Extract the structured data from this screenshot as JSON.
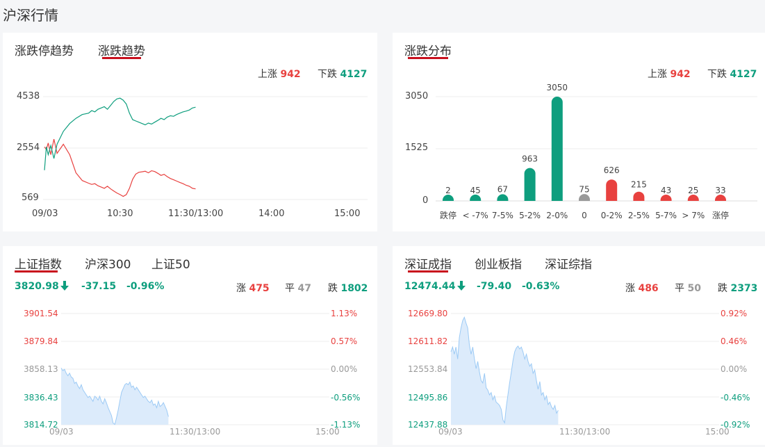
{
  "page_title": "沪深行情",
  "colors": {
    "up": "#e8413f",
    "down": "#0e9e7e",
    "flat": "#999999",
    "accent": "#c8101d",
    "area": "#dcebfb",
    "area_line": "#9ccaf5"
  },
  "trend_card": {
    "tabs": [
      {
        "label": "涨跌停趋势",
        "active": false
      },
      {
        "label": "涨跌趋势",
        "active": true
      }
    ],
    "up_label": "上涨",
    "up_value": "942",
    "down_label": "下跌",
    "down_value": "4127",
    "y_ticks": [
      "4538",
      "2554",
      "569"
    ],
    "x_ticks": [
      "09/03",
      "10:30",
      "11:30/13:00",
      "14:00",
      "15:00"
    ]
  },
  "dist_card": {
    "tabs": [
      {
        "label": "涨跌分布",
        "active": true
      }
    ],
    "up_label": "上涨",
    "up_value": "942",
    "down_label": "下跌",
    "down_value": "4127",
    "y_ticks": [
      "3050",
      "1525",
      "0"
    ]
  },
  "sh_card": {
    "tabs": [
      {
        "label": "上证指数",
        "active": true
      },
      {
        "label": "沪深300",
        "active": false
      },
      {
        "label": "上证50",
        "active": false
      }
    ],
    "price": "3820.98",
    "change": "-37.15",
    "change_pct": "-0.96%",
    "up_label": "涨",
    "up_value": "475",
    "flat_label": "平",
    "flat_value": "47",
    "down_label": "跌",
    "down_value": "1802",
    "left_ticks": [
      "3901.54",
      "3879.84",
      "3858.13",
      "3836.43",
      "3814.72"
    ],
    "right_ticks": [
      "1.13%",
      "0.57%",
      "0.00%",
      "-0.56%",
      "-1.13%"
    ],
    "x_ticks": [
      "09/03",
      "11:30/13:00",
      "15:00"
    ]
  },
  "sz_card": {
    "tabs": [
      {
        "label": "深证成指",
        "active": true
      },
      {
        "label": "创业板指",
        "active": false
      },
      {
        "label": "深证综指",
        "active": false
      }
    ],
    "price": "12474.44",
    "change": "-79.40",
    "change_pct": "-0.63%",
    "up_label": "涨",
    "up_value": "486",
    "flat_label": "平",
    "flat_value": "50",
    "down_label": "跌",
    "down_value": "2373",
    "left_ticks": [
      "12669.80",
      "12611.82",
      "12553.84",
      "12495.86",
      "12437.88"
    ],
    "right_ticks": [
      "0.92%",
      "0.46%",
      "0.00%",
      "-0.46%",
      "-0.92%"
    ],
    "x_ticks": [
      "09/03",
      "11:30/13:00",
      "15:00"
    ]
  },
  "chart_data": [
    {
      "type": "line",
      "ylim": [
        569,
        4538
      ],
      "x_ticks": [
        "09/03",
        "10:30",
        "11:30/13:00",
        "14:00",
        "15:00"
      ],
      "series": [
        {
          "name": "上涨",
          "color": "#e8413f",
          "x": [
            0,
            3,
            6,
            10,
            15,
            20,
            30,
            40,
            50,
            60,
            70,
            75,
            80,
            85,
            90,
            95,
            100,
            105,
            110,
            115,
            120,
            125,
            130,
            135,
            140,
            145,
            150,
            155,
            160,
            165,
            170,
            175,
            180,
            185,
            190,
            195,
            200,
            205,
            210,
            215,
            220,
            225,
            230,
            235,
            240
          ],
          "y": [
            2600,
            2500,
            2750,
            2300,
            2900,
            2350,
            2700,
            2300,
            1600,
            1300,
            1200,
            1150,
            1180,
            1100,
            1050,
            1000,
            1080,
            980,
            900,
            820,
            760,
            690,
            760,
            1000,
            1350,
            1550,
            1620,
            1640,
            1660,
            1600,
            1680,
            1650,
            1580,
            1500,
            1540,
            1450,
            1380,
            1330,
            1280,
            1230,
            1180,
            1120,
            1080,
            1000,
            980
          ]
        },
        {
          "name": "下跌",
          "color": "#0e9e7e",
          "x": [
            0,
            3,
            6,
            10,
            15,
            20,
            30,
            40,
            50,
            60,
            70,
            75,
            80,
            85,
            90,
            95,
            100,
            105,
            110,
            115,
            120,
            125,
            130,
            135,
            140,
            145,
            150,
            155,
            160,
            165,
            170,
            175,
            180,
            185,
            190,
            195,
            200,
            205,
            210,
            215,
            220,
            225,
            230,
            235,
            240
          ],
          "y": [
            1700,
            2600,
            2300,
            2650,
            2150,
            2700,
            3200,
            3500,
            3700,
            3850,
            3900,
            4000,
            3950,
            4050,
            4100,
            4150,
            4050,
            4200,
            4350,
            4450,
            4480,
            4400,
            4250,
            3900,
            3650,
            3600,
            3550,
            3500,
            3450,
            3520,
            3480,
            3550,
            3620,
            3700,
            3650,
            3750,
            3800,
            3780,
            3850,
            3900,
            3950,
            3980,
            4020,
            4100,
            4130
          ]
        }
      ]
    },
    {
      "type": "bar",
      "categories": [
        "跌停",
        "< -7%",
        "7-5%",
        "5-2%",
        "2-0%",
        "0",
        "0-2%",
        "2-5%",
        "5-7%",
        "> 7%",
        "涨停"
      ],
      "values": [
        2,
        45,
        67,
        963,
        3050,
        75,
        626,
        215,
        43,
        25,
        33
      ],
      "colors": [
        "#0e9e7e",
        "#0e9e7e",
        "#0e9e7e",
        "#0e9e7e",
        "#0e9e7e",
        "#999999",
        "#e8413f",
        "#e8413f",
        "#e8413f",
        "#e8413f",
        "#e8413f"
      ],
      "ylim": [
        0,
        3050
      ]
    },
    {
      "type": "area",
      "ylim": [
        3814.72,
        3901.54
      ],
      "x_ticks": [
        "09/03",
        "11:30/13:00",
        "15:00"
      ],
      "x": [
        0,
        3,
        6,
        9,
        12,
        15,
        18,
        21,
        24,
        27,
        30,
        33,
        36,
        39,
        42,
        45,
        48,
        51,
        54,
        57,
        60,
        63,
        66,
        69,
        72,
        75,
        78,
        81,
        84,
        87,
        90,
        93,
        96,
        99,
        102,
        105,
        108,
        111,
        114,
        117,
        120,
        123,
        126,
        129,
        132,
        135,
        138,
        141,
        144,
        147,
        150,
        153,
        156,
        159,
        162,
        165,
        168,
        171,
        174,
        177,
        180,
        183,
        186,
        189,
        192
      ],
      "y": [
        3859,
        3857,
        3858,
        3855,
        3853,
        3855,
        3852,
        3851,
        3847,
        3848,
        3845,
        3843,
        3846,
        3842,
        3840,
        3838,
        3836,
        3837,
        3835,
        3833,
        3837,
        3836,
        3834,
        3837,
        3833,
        3831,
        3835,
        3832,
        3828,
        3825,
        3822,
        3816,
        3815,
        3820,
        3826,
        3833,
        3840,
        3843,
        3846,
        3847,
        3846,
        3848,
        3844,
        3845,
        3842,
        3844,
        3842,
        3840,
        3838,
        3836,
        3837,
        3835,
        3833,
        3832,
        3834,
        3830,
        3831,
        3828,
        3833,
        3829,
        3830,
        3832,
        3829,
        3826,
        3821
      ]
    },
    {
      "type": "area",
      "ylim": [
        12437.88,
        12669.8
      ],
      "x_ticks": [
        "09/03",
        "11:30/13:00",
        "15:00"
      ],
      "x": [
        0,
        3,
        6,
        9,
        12,
        15,
        18,
        21,
        24,
        27,
        30,
        33,
        36,
        39,
        42,
        45,
        48,
        51,
        54,
        57,
        60,
        63,
        66,
        69,
        72,
        75,
        78,
        81,
        84,
        87,
        90,
        93,
        96,
        99,
        102,
        105,
        108,
        111,
        114,
        117,
        120,
        123,
        126,
        129,
        132,
        135,
        138,
        141,
        144,
        147,
        150,
        153,
        156,
        159,
        162,
        165,
        168,
        171,
        174,
        177,
        180,
        183,
        186,
        189,
        192
      ],
      "y": [
        12590,
        12600,
        12585,
        12600,
        12575,
        12620,
        12640,
        12655,
        12662,
        12650,
        12640,
        12605,
        12585,
        12600,
        12575,
        12555,
        12570,
        12548,
        12530,
        12525,
        12545,
        12515,
        12510,
        12500,
        12505,
        12490,
        12498,
        12485,
        12482,
        12478,
        12470,
        12448,
        12442,
        12475,
        12500,
        12525,
        12548,
        12572,
        12590,
        12598,
        12602,
        12596,
        12600,
        12590,
        12575,
        12585,
        12570,
        12560,
        12565,
        12545,
        12552,
        12530,
        12512,
        12528,
        12500,
        12505,
        12490,
        12498,
        12480,
        12485,
        12475,
        12470,
        12478,
        12462,
        12468
      ]
    }
  ]
}
